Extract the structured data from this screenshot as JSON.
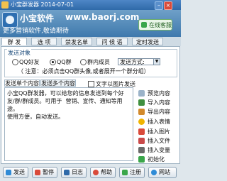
{
  "window": {
    "title": "小宝群发器  2014-07-01",
    "min_label": "–",
    "close_label": "×"
  },
  "banner": {
    "brand_name": "小宝软件",
    "brand_url": "www.baorj.com",
    "slogan": "更多营销软件,敬请期待",
    "online_service": "在线客服"
  },
  "tabs": [
    "群 发",
    "选 项",
    "禁发名单",
    "问 候 语",
    "定时发送"
  ],
  "target": {
    "legend": "发送对象",
    "options": [
      "QQ好友",
      "QQ群",
      "群内成员"
    ],
    "selected": 1,
    "send_mode": "发送方式:",
    "note": "（ 注意：必须点击QQ群头像,或者展开一个群分组）"
  },
  "content": {
    "tabs": [
      "发送单个内容",
      "发送多个内容"
    ],
    "image_text_label": "文字以图片发送",
    "editor_text": "小宝QQ群发器，可以给您的信息发送到每个好友/群/群成员。可用于  营销、宣传、通知等用途。\n使用方便，自动发送。"
  },
  "side_buttons": [
    {
      "label": "预览内容",
      "icon": "preview-icon",
      "color": "#9bb3c9"
    },
    {
      "label": "导入内容",
      "icon": "import-icon",
      "color": "#3f8f3f"
    },
    {
      "label": "导出内容",
      "icon": "export-icon",
      "color": "#d28a2c"
    },
    {
      "label": "插入表情",
      "icon": "emoji-icon",
      "color": "#f0b400"
    },
    {
      "label": "插入图片",
      "icon": "image-icon",
      "color": "#d94a3a"
    },
    {
      "label": "插入文件",
      "icon": "file-icon",
      "color": "#c94a4a"
    },
    {
      "label": "插入变量",
      "icon": "variable-icon",
      "color": "#6a6a6a"
    },
    {
      "label": "初始化",
      "icon": "init-icon",
      "color": "#3aa64a"
    }
  ],
  "bottom_buttons": [
    {
      "label": "发送",
      "icon": "send-icon",
      "color": "#2f8bd6"
    },
    {
      "label": "暂停",
      "icon": "pause-icon",
      "color": "#d94a3a"
    },
    {
      "label": "日志",
      "icon": "log-icon",
      "color": "#2f6aa9"
    },
    {
      "label": "帮助",
      "icon": "help-icon",
      "color": "#d94a3a"
    },
    {
      "label": "注册",
      "icon": "register-icon",
      "color": "#3aa64a"
    },
    {
      "label": "网站",
      "icon": "website-icon",
      "color": "#2f8bd6"
    }
  ]
}
